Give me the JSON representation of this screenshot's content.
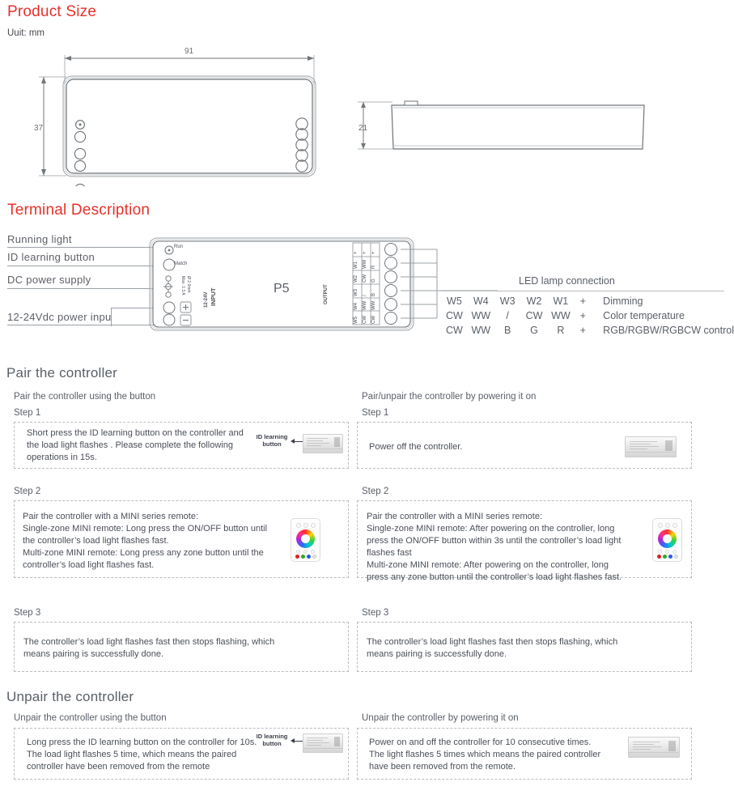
{
  "sections": {
    "product_size": {
      "title": "Product Size",
      "unit": "Uuit: mm",
      "dim_width": "91",
      "dim_height": "37",
      "dim_depth": "21"
    },
    "terminal_description": {
      "title": "Terminal Description",
      "labels": [
        "Running  light",
        "ID  learning  button",
        "DC  power  supply",
        "12-24Vdc power inpu"
      ],
      "device": {
        "model": "P5",
        "run_label": "Run",
        "match_label": "Match",
        "dc_spec_1": "Max: 1.3 A",
        "dc_spec_2": "Ø 2.0mm",
        "input_label": "INPUT",
        "input_voltage": "12-24V",
        "input_plus": "+",
        "input_minus": "-",
        "output_label": "OUTPUT",
        "output_rows": [
          [
            "+",
            "+",
            "+"
          ],
          [
            "W1",
            "WW",
            "R"
          ],
          [
            "W2",
            "CW",
            "G"
          ],
          [
            "W3",
            "/",
            "B"
          ],
          [
            "W4",
            "WW",
            "WW"
          ],
          [
            "W5",
            "CW",
            "CW"
          ]
        ]
      },
      "led_connection": {
        "title": "LED lamp connection",
        "rows": [
          {
            "pins": [
              "W5",
              "W4",
              "W3",
              "W2",
              "W1",
              "+"
            ],
            "desc": "Dimming"
          },
          {
            "pins": [
              "CW",
              "WW",
              "/",
              "CW",
              "WW",
              "+"
            ],
            "desc": "Color temperature"
          },
          {
            "pins": [
              "CW",
              "WW",
              "B",
              "G",
              "R",
              "+"
            ],
            "desc": "RGB/RGBW/RGBCW control"
          }
        ]
      }
    },
    "pair": {
      "title": "Pair the controller",
      "columns": [
        {
          "heading": "Pair the controller using the button",
          "steps": [
            {
              "label": "Step 1",
              "lines": [
                "Short press the ID learning button on the controller and",
                "the load light flashes . Please complete the following",
                "operations in 15s."
              ],
              "thumb": "controller",
              "caption": "ID learning\nbutton"
            },
            {
              "label": "Step 2",
              "lines": [
                "Pair the controller with a MINI series remote:",
                "Single-zone MINI remote: Long press the ON/OFF button until",
                "the controller’s load light flashes fast.",
                "Multi-zone MINI remote: Long press any zone button until the",
                "controller’s load light flashes fast."
              ],
              "thumb": "remote",
              "caption": ""
            },
            {
              "label": "Step 3",
              "lines": [
                "The controller’s load light flashes fast then stops flashing, which",
                "means pairing is successfully done."
              ],
              "thumb": "none",
              "caption": ""
            }
          ]
        },
        {
          "heading": "Pair/unpair the controller by powering it on",
          "steps": [
            {
              "label": "Step 1",
              "lines": [
                "Power off the controller."
              ],
              "thumb": "controller-plain",
              "caption": ""
            },
            {
              "label": "Step 2",
              "lines": [
                "Pair the controller with a MINI series remote:",
                "Single-zone MINI remote: After powering on the controller, long",
                "press the ON/OFF button within 3s until the controller’s load light",
                "flashes fast",
                "Multi-zone MINI remote:  After powering on the controller, long",
                "press any zone button until the controller’s load light flashes fast."
              ],
              "thumb": "remote",
              "caption": ""
            },
            {
              "label": "Step 3",
              "lines": [
                "The controller’s load light flashes fast then stops flashing, which",
                "means pairing is successfully done."
              ],
              "thumb": "none",
              "caption": ""
            }
          ]
        }
      ]
    },
    "unpair": {
      "title": "Unpair the controller",
      "columns": [
        {
          "heading": "Unpair the controller using the button",
          "lines": [
            "Long press the ID learning button on the controller for 10s.",
            "The load light flashes 5 time, which means the paired",
            "controller have been removed from the remote"
          ],
          "thumb": "controller",
          "caption": "ID learning\nbutton"
        },
        {
          "heading": "Unpair the controller by powering it on",
          "lines": [
            "Power on and off the controller for 10 consecutive times.",
            "The light flashes 5 times which means the paired controller",
            "have been removed from the remote."
          ],
          "thumb": "controller-plain",
          "caption": ""
        }
      ]
    }
  },
  "colors": {
    "heading_red": "#e8312b",
    "heading_gray": "#5a6068",
    "body_text": "#4a4f58",
    "line": "#9aa0a6"
  }
}
